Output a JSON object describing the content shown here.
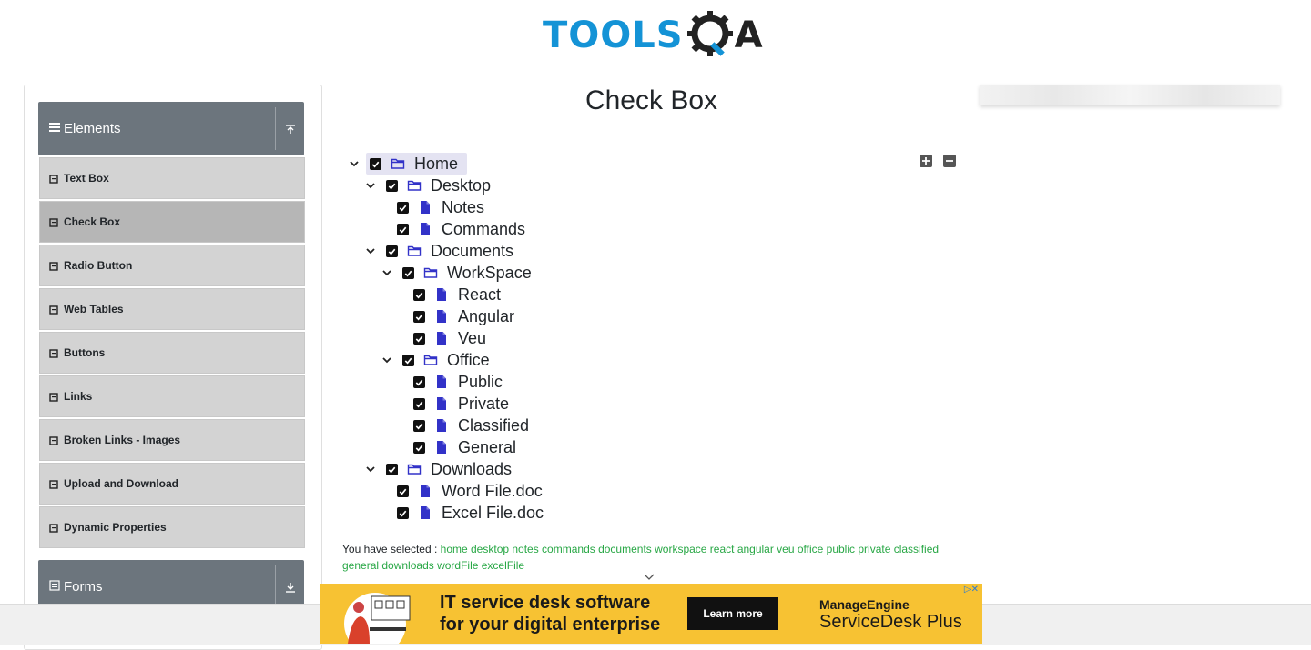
{
  "header": {
    "logo_main": "TOOLS",
    "logo_tail": "A"
  },
  "sidebar": {
    "elements_group": "Elements",
    "forms_group": "Forms",
    "items": [
      {
        "label": "Text Box"
      },
      {
        "label": "Check Box"
      },
      {
        "label": "Radio Button"
      },
      {
        "label": "Web Tables"
      },
      {
        "label": "Buttons"
      },
      {
        "label": "Links"
      },
      {
        "label": "Broken Links - Images"
      },
      {
        "label": "Upload and Download"
      },
      {
        "label": "Dynamic Properties"
      }
    ]
  },
  "main": {
    "title": "Check Box",
    "tree": {
      "home": "Home",
      "desktop": "Desktop",
      "notes": "Notes",
      "commands": "Commands",
      "documents": "Documents",
      "workspace": "WorkSpace",
      "react": "React",
      "angular": "Angular",
      "veu": "Veu",
      "office": "Office",
      "public": "Public",
      "private": "Private",
      "classified": "Classified",
      "general": "General",
      "downloads": "Downloads",
      "wordfile": "Word File.doc",
      "excelfile": "Excel File.doc"
    },
    "result_label": "You have selected :",
    "result_values": "home desktop notes commands documents workspace react angular veu office public private classified general downloads wordFile excelFile"
  },
  "ad": {
    "headline_line1": "IT service desk software",
    "headline_line2": "for your digital enterprise",
    "cta": "Learn more",
    "brand_small": "ManageEngine",
    "brand_large": "ServiceDesk Plus"
  },
  "colors": {
    "brand_blue": "#1493d6",
    "sidebar_header": "#6c757d",
    "selected_green": "#28a745",
    "file_icon": "#3232c8",
    "ad_yellow": "#f7c233"
  },
  "icons": {
    "expand": "chevron-down-icon",
    "checkbox": "checkbox-checked-icon",
    "folder": "folder-icon",
    "file": "file-icon",
    "expand_all": "plus-square-icon",
    "collapse_all": "minus-square-icon"
  }
}
